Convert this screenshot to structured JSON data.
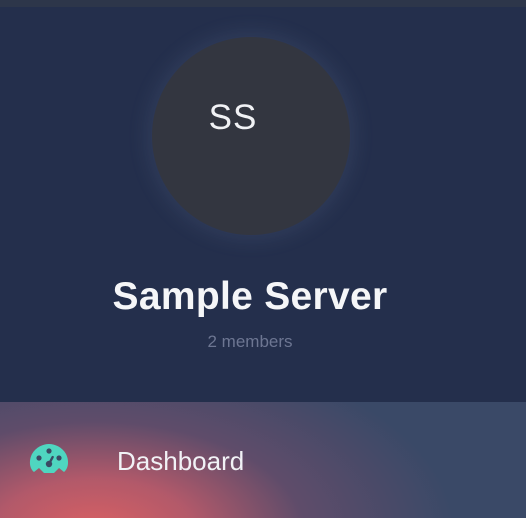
{
  "server": {
    "initials": "SS",
    "name": "Sample Server",
    "member_count": "2 members"
  },
  "nav": {
    "items": [
      {
        "label": "Dashboard",
        "icon": "dashboard-gauge-icon",
        "active": true
      }
    ]
  },
  "colors": {
    "header_background": "#242f4c",
    "avatar_background": "#333640",
    "active_item_gradient": "#d96163",
    "icon_accent": "#4fd6c0"
  }
}
